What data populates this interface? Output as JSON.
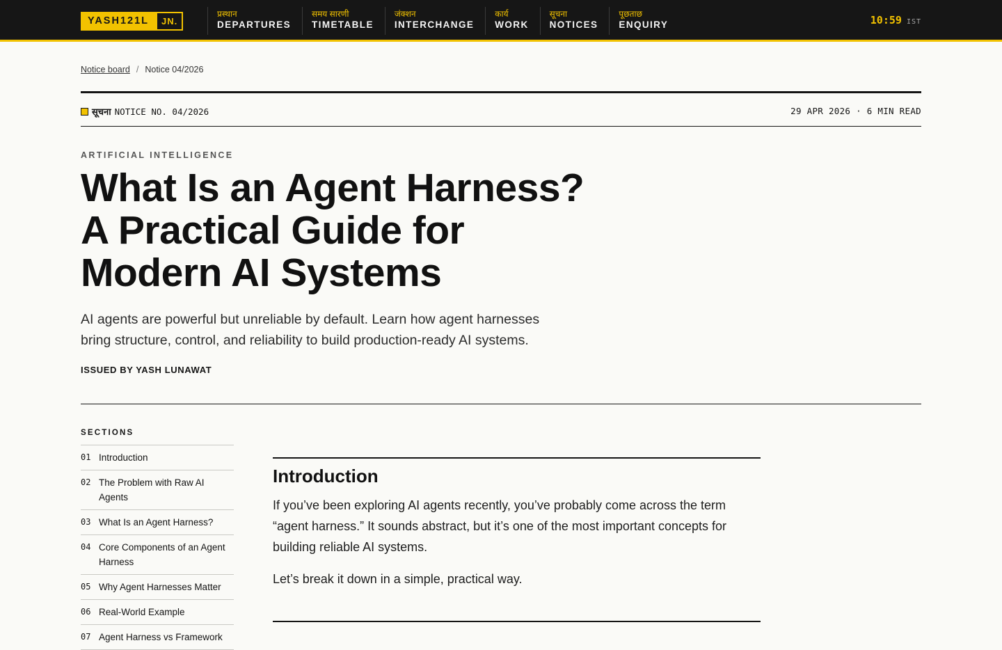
{
  "brand": {
    "name": "YASH121L",
    "suffix": "JN."
  },
  "nav": [
    {
      "hindi": "प्रस्थान",
      "english": "DEPARTURES"
    },
    {
      "hindi": "समय सारणी",
      "english": "TIMETABLE"
    },
    {
      "hindi": "जंक्शन",
      "english": "INTERCHANGE"
    },
    {
      "hindi": "कार्य",
      "english": "WORK"
    },
    {
      "hindi": "सूचना",
      "english": "NOTICES"
    },
    {
      "hindi": "पूछताछ",
      "english": "ENQUIRY"
    }
  ],
  "clock": {
    "time": "10:59",
    "zone": "IST"
  },
  "breadcrumb": {
    "parent": "Notice board",
    "separator": "/",
    "current": "Notice 04/2026"
  },
  "notice": {
    "hindi_label": "सूचना",
    "number": "NOTICE NO. 04/2026",
    "date_read": "29 APR 2026 · 6 MIN READ"
  },
  "article": {
    "category": "ARTIFICIAL INTELLIGENCE",
    "title_lines": [
      "What Is an Agent Harness?",
      "A Practical Guide for",
      "Modern AI Systems"
    ],
    "dek": "AI agents are powerful but unreliable by default. Learn how agent harnesses bring structure, control, and reliability to build production-ready AI systems.",
    "byline": "ISSUED BY YASH LUNAWAT"
  },
  "toc": {
    "title": "SECTIONS",
    "items": [
      {
        "num": "01",
        "label": "Introduction"
      },
      {
        "num": "02",
        "label": "The Problem with Raw AI Agents"
      },
      {
        "num": "03",
        "label": "What Is an Agent Harness?"
      },
      {
        "num": "04",
        "label": "Core Components of an Agent Harness"
      },
      {
        "num": "05",
        "label": "Why Agent Harnesses Matter"
      },
      {
        "num": "06",
        "label": "Real-World Example"
      },
      {
        "num": "07",
        "label": "Agent Harness vs Framework"
      }
    ]
  },
  "section": {
    "title": "Introduction",
    "paragraphs": [
      "If you’ve been exploring AI agents recently, you’ve probably come across the term “agent harness.” It sounds abstract, but it’s one of the most important concepts for building reliable AI systems.",
      "Let’s break it down in a simple, practical way."
    ]
  },
  "colors": {
    "accent": "#f2c200",
    "bar": "#161616",
    "page": "#fafaf7",
    "ink": "#141414"
  }
}
